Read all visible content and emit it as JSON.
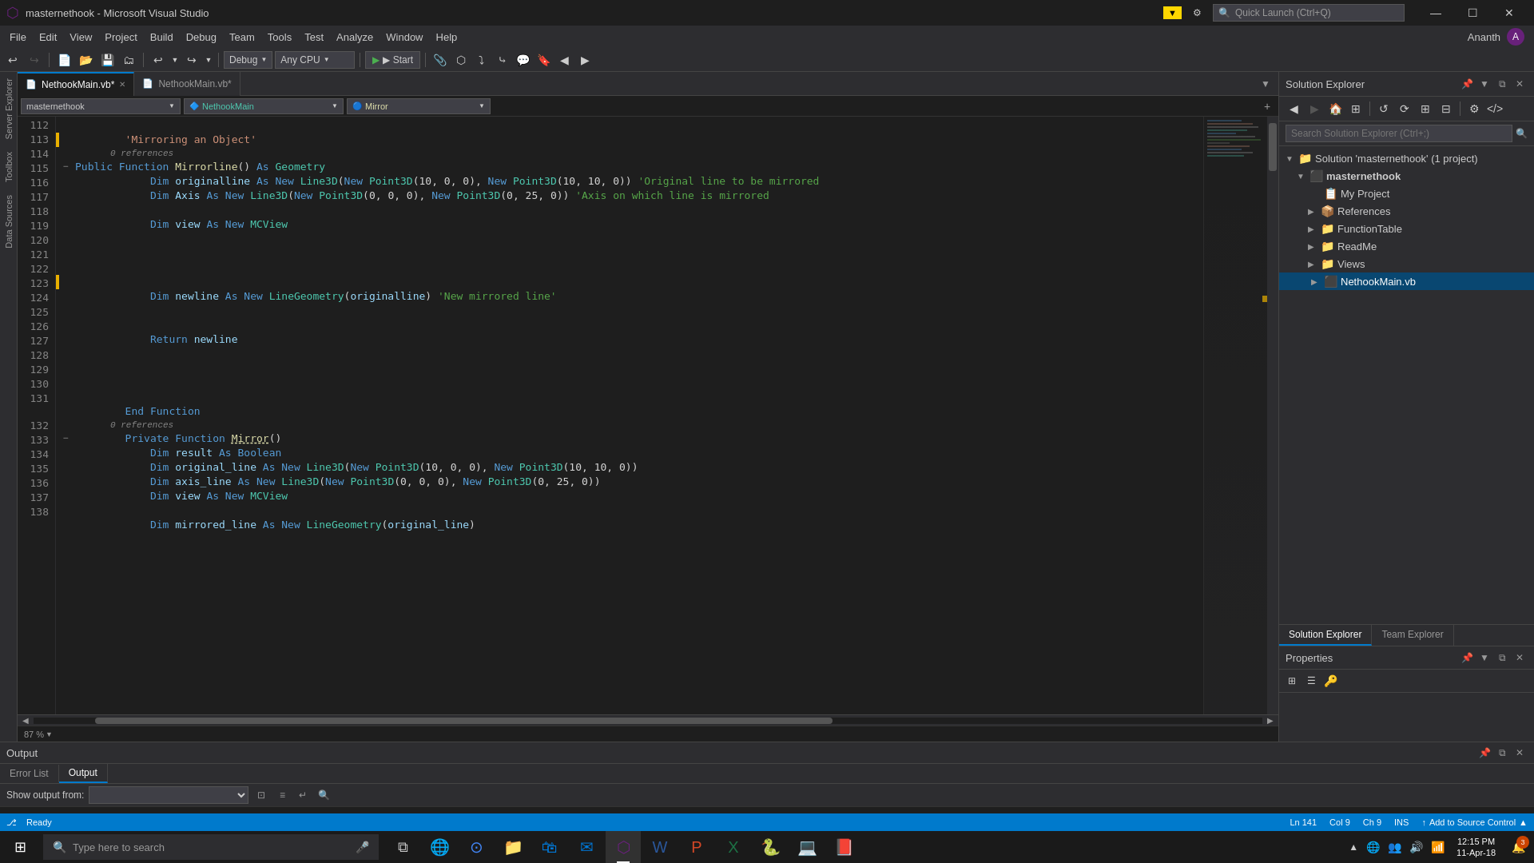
{
  "titleBar": {
    "title": "masternethook - Microsoft Visual Studio",
    "quickLaunch": "Quick Launch (Ctrl+Q)",
    "filterIcon": "▼",
    "winBtns": [
      "—",
      "☐",
      "✕"
    ]
  },
  "menuBar": {
    "items": [
      "File",
      "Edit",
      "View",
      "Project",
      "Build",
      "Debug",
      "Team",
      "Tools",
      "Test",
      "Analyze",
      "Window",
      "Help"
    ]
  },
  "toolbar": {
    "debugConfig": "Debug",
    "platform": "Any CPU",
    "startLabel": "▶ Start"
  },
  "tabs": {
    "tab1": "NethookMain.vb*",
    "tab2": "NethookMain.vb*"
  },
  "editorNav": {
    "module": "masternethook",
    "class": "NethookMain",
    "member": "Mirror"
  },
  "code": {
    "lines": [
      {
        "num": "112",
        "indent": "",
        "text": "",
        "type": "blank"
      },
      {
        "num": "113",
        "indent": "        ",
        "text": "'Mirroring an Object'",
        "type": "comment",
        "refNote": "0 references"
      },
      {
        "num": "114",
        "indent": "        ",
        "text": "Public Function Mirrorline() As Geometry",
        "type": "code"
      },
      {
        "num": "115",
        "indent": "            ",
        "text": "Dim originalline As New Line3D(New Point3D(10, 0, 0), New Point3D(10, 10, 0)) 'Original line to be mirrored",
        "type": "code"
      },
      {
        "num": "116",
        "indent": "            ",
        "text": "Dim Axis As New Line3D(New Point3D(0, 0, 0), New Point3D(0, 25, 0)) 'Axis on which line is mirrored",
        "type": "code"
      },
      {
        "num": "117",
        "indent": "",
        "text": "",
        "type": "blank"
      },
      {
        "num": "118",
        "indent": "            ",
        "text": "Dim view As New MCView",
        "type": "code"
      },
      {
        "num": "119",
        "indent": "",
        "text": "",
        "type": "blank"
      },
      {
        "num": "120",
        "indent": "",
        "text": "",
        "type": "blank"
      },
      {
        "num": "121",
        "indent": "",
        "text": "",
        "type": "blank"
      },
      {
        "num": "122",
        "indent": "",
        "text": "",
        "type": "blank"
      },
      {
        "num": "123",
        "indent": "            ",
        "text": "Dim newline As New LineGeometry(originalline) 'New mirrored line'",
        "type": "code"
      },
      {
        "num": "124",
        "indent": "",
        "text": "",
        "type": "blank"
      },
      {
        "num": "125",
        "indent": "",
        "text": "",
        "type": "blank"
      },
      {
        "num": "126",
        "indent": "            ",
        "text": "Return newline",
        "type": "code"
      },
      {
        "num": "127",
        "indent": "",
        "text": "",
        "type": "blank"
      },
      {
        "num": "128",
        "indent": "",
        "text": "",
        "type": "blank"
      },
      {
        "num": "129",
        "indent": "",
        "text": "",
        "type": "blank"
      },
      {
        "num": "130",
        "indent": "",
        "text": "",
        "type": "blank"
      },
      {
        "num": "131",
        "indent": "        ",
        "text": "End Function",
        "type": "code"
      },
      {
        "num": "132",
        "indent": "        ",
        "text": "Private Function Mirror()",
        "type": "code",
        "refNote": "0 references"
      },
      {
        "num": "133",
        "indent": "            ",
        "text": "Dim result As Boolean",
        "type": "code"
      },
      {
        "num": "134",
        "indent": "            ",
        "text": "Dim original_line As New Line3D(New Point3D(10, 0, 0), New Point3D(10, 10, 0))",
        "type": "code"
      },
      {
        "num": "135",
        "indent": "            ",
        "text": "Dim axis_line As New Line3D(New Point3D(0, 0, 0), New Point3D(0, 25, 0))",
        "type": "code"
      },
      {
        "num": "136",
        "indent": "            ",
        "text": "Dim view As New MCView",
        "type": "code"
      },
      {
        "num": "137",
        "indent": "",
        "text": "",
        "type": "blank"
      },
      {
        "num": "138",
        "indent": "            ",
        "text": "Dim mirrored_line As New LineGeometry(original_line)",
        "type": "code"
      }
    ]
  },
  "solutionExplorer": {
    "title": "Solution Explorer",
    "searchPlaceholder": "Search Solution Explorer (Ctrl+;)",
    "solution": "Solution 'masternethook' (1 project)",
    "project": "masternethook",
    "items": [
      "My Project",
      "References",
      "FunctionTable",
      "ReadMe",
      "Views",
      "NethookMain.vb"
    ]
  },
  "seTabs": {
    "tab1": "Solution Explorer",
    "tab2": "Team Explorer"
  },
  "properties": {
    "title": "Properties"
  },
  "output": {
    "title": "Output",
    "showOutputFrom": "Show output from:",
    "tabs": [
      "Error List",
      "Output"
    ]
  },
  "statusBar": {
    "ready": "Ready",
    "ln": "Ln 141",
    "col": "Col 9",
    "ch": "Ch 9",
    "ins": "INS",
    "sourceControl": "Add to Source Control"
  },
  "taskbar": {
    "searchPlaceholder": "Type here to search",
    "clock": "12:15 PM",
    "date": "11-Apr-18",
    "notifCount": "3"
  },
  "zoom": {
    "level": "87 %"
  }
}
